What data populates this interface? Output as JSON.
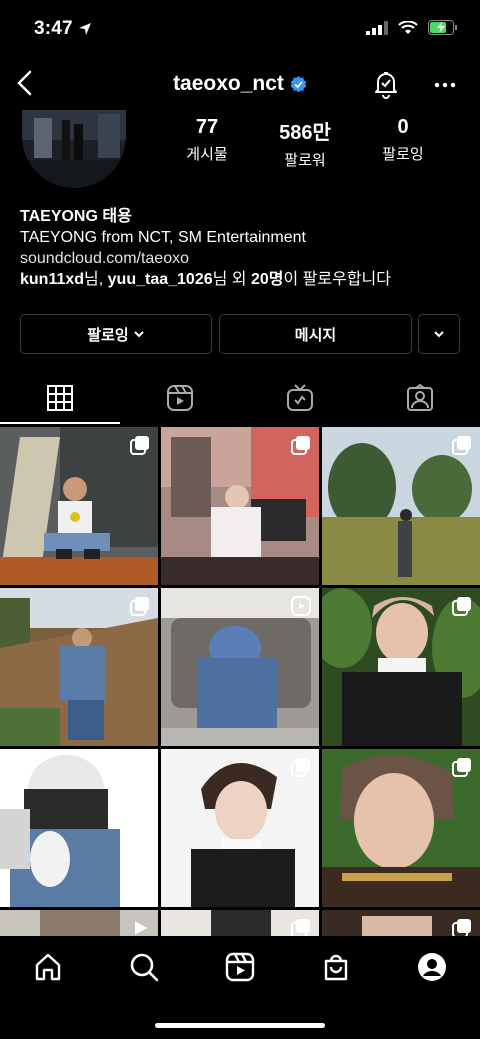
{
  "status_bar": {
    "time": "3:47"
  },
  "header": {
    "username": "taeoxo_nct"
  },
  "profile": {
    "stats": [
      {
        "value": "77",
        "label": "게시물"
      },
      {
        "value": "586만",
        "label": "팔로워"
      },
      {
        "value": "0",
        "label": "팔로잉"
      }
    ],
    "bio_name": "TAEYONG 태용",
    "bio_text": "TAEYONG from NCT, SM Entertainment",
    "bio_link": "soundcloud.com/taeoxo",
    "followed_by": {
      "user1": "kun11xd",
      "suffix1": "님, ",
      "user2": "yuu_taa_1026",
      "suffix2": "님 외 ",
      "count": "20명",
      "suffix3": "이 팔로우합니다"
    }
  },
  "actions": {
    "following_label": "팔로잉",
    "message_label": "메시지"
  },
  "tabs": [
    "grid-icon",
    "reels-icon",
    "igtv-icon",
    "tagged-icon"
  ],
  "nav": [
    "home-icon",
    "search-icon",
    "reels-icon",
    "shop-icon",
    "profile-icon"
  ],
  "colors": {
    "background": "#000000",
    "verified": "#3897f0",
    "border": "#3a3a3a"
  }
}
